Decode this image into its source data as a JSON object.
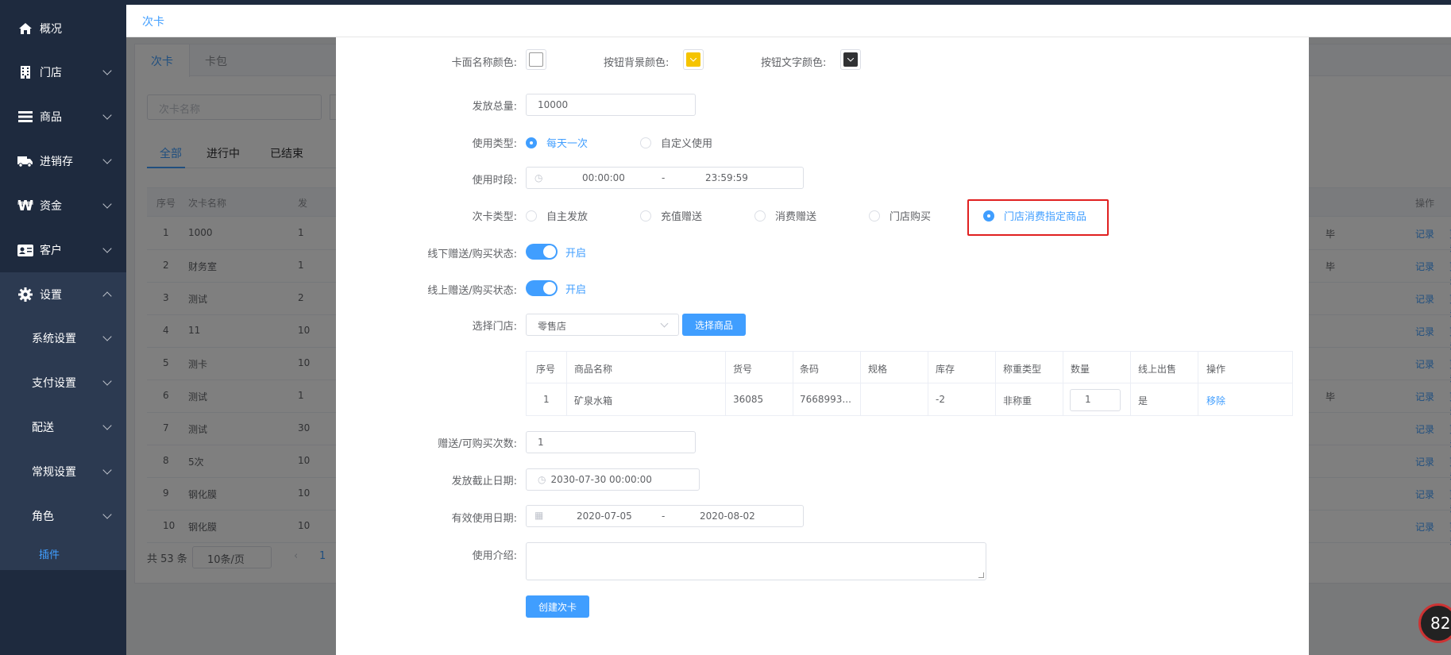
{
  "sidebar": {
    "items": [
      {
        "label": "概况",
        "icon": "home-icon"
      },
      {
        "label": "门店",
        "icon": "building-icon"
      },
      {
        "label": "商品",
        "icon": "list-icon"
      },
      {
        "label": "进销存",
        "icon": "truck-icon"
      },
      {
        "label": "资金",
        "icon": "won-icon"
      },
      {
        "label": "客户",
        "icon": "id-card-icon"
      },
      {
        "label": "设置",
        "icon": "gear-icon"
      }
    ],
    "sub_items": [
      {
        "label": "系统设置"
      },
      {
        "label": "支付设置"
      },
      {
        "label": "配送"
      },
      {
        "label": "常规设置"
      },
      {
        "label": "角色"
      }
    ],
    "plugin_label": "插件"
  },
  "topbar": {
    "title": "次卡"
  },
  "background_page": {
    "tabs": [
      "次卡",
      "卡包"
    ],
    "search_placeholder": "次卡名称",
    "subtabs": [
      "全部",
      "进行中",
      "已结束"
    ],
    "columns": [
      "序号",
      "次卡名称",
      "发",
      "操作"
    ],
    "rows": [
      {
        "no": "1",
        "name": "1000",
        "c3": "1",
        "extra": "毕"
      },
      {
        "no": "2",
        "name": "财务室",
        "c3": "1",
        "extra": "毕"
      },
      {
        "no": "3",
        "name": "测试",
        "c3": "2",
        "extra": ""
      },
      {
        "no": "4",
        "name": "11",
        "c3": "10",
        "extra": ""
      },
      {
        "no": "5",
        "name": "测卡",
        "c3": "10",
        "extra": ""
      },
      {
        "no": "6",
        "name": "测试",
        "c3": "1",
        "extra": "毕"
      },
      {
        "no": "7",
        "name": "测试",
        "c3": "30",
        "extra": ""
      },
      {
        "no": "8",
        "name": "5次",
        "c3": "10",
        "extra": ""
      },
      {
        "no": "9",
        "name": "钢化膜",
        "c3": "10",
        "extra": ""
      },
      {
        "no": "10",
        "name": "钢化膜",
        "c3": "10",
        "extra": ""
      }
    ],
    "row_action_record": "记录",
    "row_action_more": "更多",
    "pager_total": "共 53 条",
    "pager_size": "10条/页",
    "pager_page": "1"
  },
  "form": {
    "card_name_color_label": "卡面名称颜色:",
    "btn_bg_color_label": "按钮背景颜色:",
    "btn_text_color_label": "按钮文字颜色:",
    "colors": {
      "card_name": "#ffffff",
      "btn_bg": "#f5c400",
      "btn_text": "#303133"
    },
    "total_label": "发放总量:",
    "total_value": "10000",
    "use_type_label": "使用类型:",
    "use_type_options": [
      "每天一次",
      "自定义使用"
    ],
    "use_type_selected": "每天一次",
    "use_period_label": "使用时段:",
    "use_period_start": "00:00:00",
    "use_period_sep": "-",
    "use_period_end": "23:59:59",
    "card_type_label": "次卡类型:",
    "card_type_options": [
      "自主发放",
      "充值赠送",
      "消费赠送",
      "门店购买",
      "门店消费指定商品"
    ],
    "card_type_selected": "门店消费指定商品",
    "offline_label": "线下赠送/购买状态:",
    "offline_state": "开启",
    "online_label": "线上赠送/购买状态:",
    "online_state": "开启",
    "store_label": "选择门店:",
    "store_value": "零售店",
    "select_goods_button": "选择商品",
    "goods_columns": [
      "序号",
      "商品名称",
      "货号",
      "条码",
      "规格",
      "库存",
      "称重类型",
      "数量",
      "线上出售",
      "操作"
    ],
    "goods_rows": [
      {
        "no": "1",
        "name": "矿泉水箱",
        "sku": "36085",
        "barcode": "7668993...",
        "spec": "",
        "stock": "-2",
        "weigh": "非称重",
        "qty": "1",
        "online": "是",
        "action": "移除"
      }
    ],
    "times_label": "赠送/可购买次数:",
    "times_value": "1",
    "deadline_label": "发放截止日期:",
    "deadline_value": "2030-07-30 00:00:00",
    "valid_label": "有效使用日期:",
    "valid_start": "2020-07-05",
    "valid_sep": "-",
    "valid_end": "2020-08-02",
    "intro_label": "使用介绍:",
    "create_button": "创建次卡"
  },
  "badge_text": "82"
}
